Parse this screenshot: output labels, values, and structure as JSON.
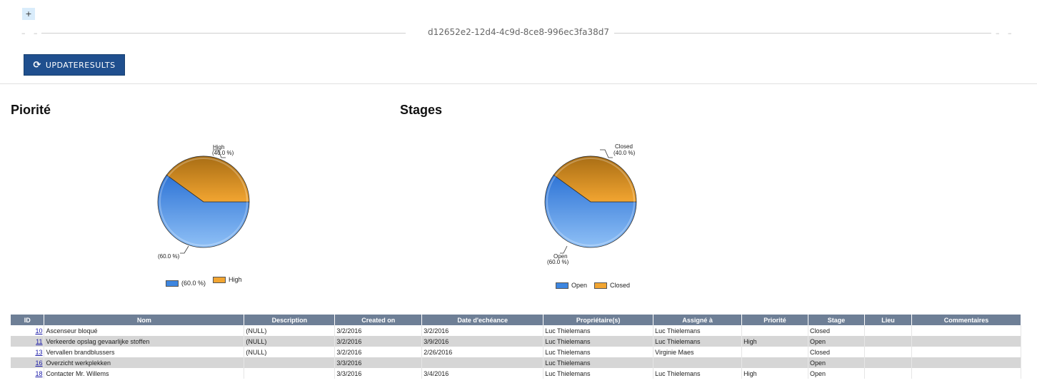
{
  "toolbar": {
    "plus_label": "+",
    "guid": "d12652e2-12d4-4c9d-8ce8-996ec3fa38d7",
    "update_label": "UPDATERESULTS",
    "update_icon": "refresh-icon"
  },
  "charts": {
    "priority": {
      "title": "Piorité",
      "slice_labels": [
        "(60.0 %)",
        "High",
        "(40.0 %)"
      ],
      "legend": [
        {
          "label": "(60.0 %)",
          "color": "#3d86e0"
        },
        {
          "label": "High",
          "color": "#f2a531"
        }
      ]
    },
    "stages": {
      "title": "Stages",
      "slice_labels": [
        "Open",
        "(60.0 %)",
        "Closed",
        "(40.0 %)"
      ],
      "legend": [
        {
          "label": "Open",
          "color": "#3d86e0"
        },
        {
          "label": "Closed",
          "color": "#f2a531"
        }
      ]
    }
  },
  "chart_data": [
    {
      "type": "pie",
      "title": "Piorité",
      "categories": [
        "",
        "High"
      ],
      "values": [
        60.0,
        40.0
      ],
      "colors": [
        "#3d86e0",
        "#f2a531"
      ],
      "legend": "bottom"
    },
    {
      "type": "pie",
      "title": "Stages",
      "categories": [
        "Open",
        "Closed"
      ],
      "values": [
        60.0,
        40.0
      ],
      "colors": [
        "#3d86e0",
        "#f2a531"
      ],
      "legend": "bottom"
    }
  ],
  "table": {
    "headers": [
      "ID",
      "Nom",
      "Description",
      "Created on",
      "Date d'echéance",
      "Propriétaire(s)",
      "Assigné à",
      "Priorité",
      "Stage",
      "Lieu",
      "Commentaires"
    ],
    "rows": [
      [
        "10",
        "Ascenseur bloqué",
        "(NULL)",
        "3/2/2016",
        "3/2/2016",
        "Luc Thielemans",
        "Luc Thielemans",
        "",
        "Closed",
        "",
        ""
      ],
      [
        "11",
        "Verkeerde opslag gevaarlijke stoffen",
        "(NULL)",
        "3/2/2016",
        "3/9/2016",
        "Luc Thielemans",
        "Luc Thielemans",
        "High",
        "Open",
        "",
        ""
      ],
      [
        "13",
        "Vervallen brandblussers",
        "(NULL)",
        "3/2/2016",
        "2/26/2016",
        "Luc Thielemans",
        "Virginie Maes",
        "",
        "Closed",
        "",
        ""
      ],
      [
        "16",
        "Overzicht werkplekken",
        "",
        "3/3/2016",
        "",
        "Luc Thielemans",
        "",
        "",
        "Open",
        "",
        ""
      ],
      [
        "18",
        "Contacter Mr. Willems",
        "",
        "3/3/2016",
        "3/4/2016",
        "Luc Thielemans",
        "Luc Thielemans",
        "High",
        "Open",
        "",
        ""
      ]
    ]
  }
}
